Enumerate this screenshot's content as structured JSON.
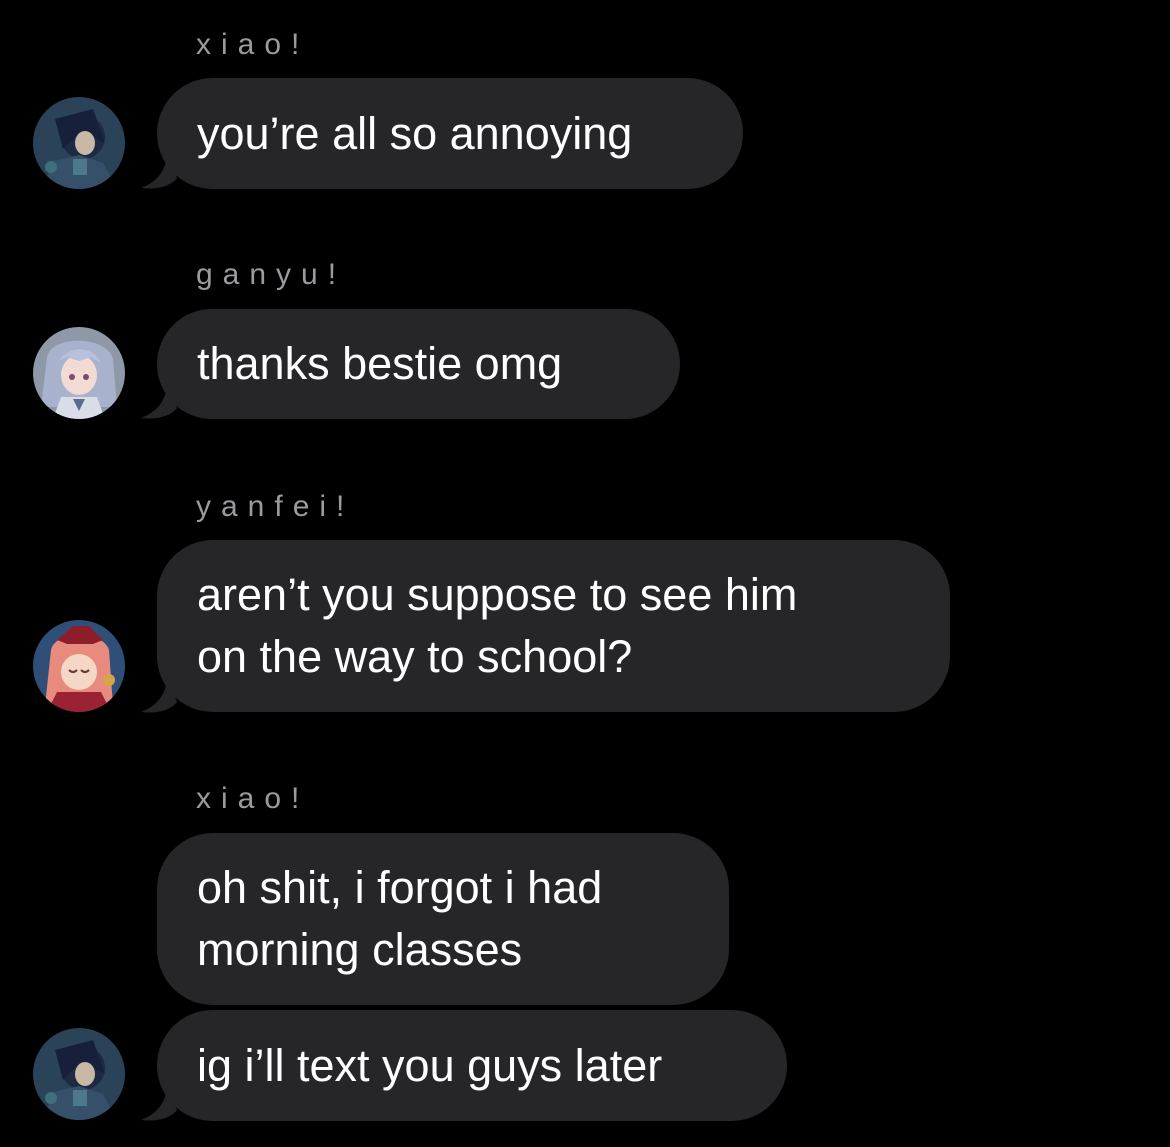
{
  "colors": {
    "background": "#000000",
    "bubble": "#262629",
    "sender_text": "#9a9a9f",
    "message_text": "#ffffff"
  },
  "messages": [
    {
      "sender": "xiao!",
      "text": "you’re all so annoying",
      "avatar": "xiao-avatar-icon"
    },
    {
      "sender": "ganyu!",
      "text": "thanks bestie omg",
      "avatar": "ganyu-avatar-icon"
    },
    {
      "sender": "yanfei!",
      "text": "aren’t you suppose to see him\non the way to school?",
      "avatar": "yanfei-avatar-icon"
    },
    {
      "sender": "xiao!",
      "text": "oh shit, i forgot i had\nmorning classes",
      "avatar": null
    },
    {
      "sender": null,
      "text": "ig i’ll text you guys later",
      "avatar": "xiao-avatar-icon"
    }
  ]
}
